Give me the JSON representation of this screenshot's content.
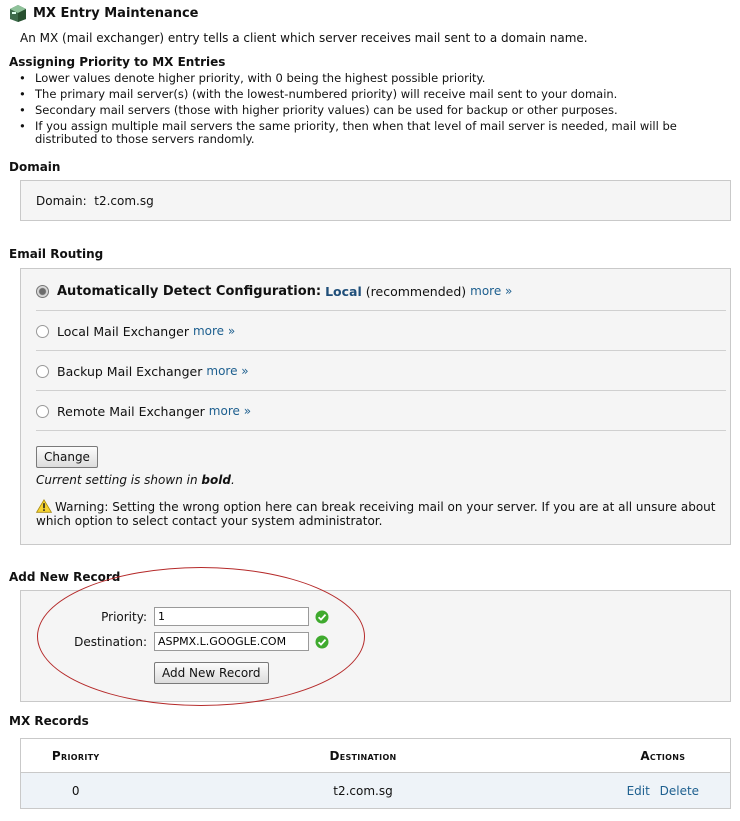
{
  "header": {
    "title": "MX Entry Maintenance",
    "icon": "mail-server-icon"
  },
  "intro": "An MX (mail exchanger) entry tells a client which server receives mail sent to a domain name.",
  "priority_section": {
    "heading": "Assigning Priority to MX Entries",
    "bullets": [
      "Lower values denote higher priority, with 0 being the highest possible priority.",
      "The primary mail server(s) (with the lowest-numbered priority) will receive mail sent to your domain.",
      "Secondary mail servers (those with higher priority values) can be used for backup or other purposes.",
      "If you assign multiple mail servers the same priority, then when that level of mail server is needed, mail will be distributed to those servers randomly."
    ]
  },
  "domain_section": {
    "heading": "Domain",
    "label": "Domain:",
    "value": "t2.com.sg"
  },
  "routing_section": {
    "heading": "Email Routing",
    "options": [
      {
        "label": "Automatically Detect Configuration:",
        "detected": "Local",
        "suffix": "(recommended)",
        "more": "more »",
        "selected": true
      },
      {
        "label": "Local Mail Exchanger",
        "more": "more »",
        "selected": false
      },
      {
        "label": "Backup Mail Exchanger",
        "more": "more »",
        "selected": false
      },
      {
        "label": "Remote Mail Exchanger",
        "more": "more »",
        "selected": false
      }
    ],
    "change_button": "Change",
    "note_prefix": "Current setting is shown in",
    "note_bold": "bold",
    "note_suffix": ".",
    "warning": "Warning: Setting the wrong option here can break receiving mail on your server. If you are at all unsure about which option to select contact your system administrator."
  },
  "add_section": {
    "heading": "Add New Record",
    "priority_label": "Priority:",
    "priority_value": "1",
    "destination_label": "Destination:",
    "destination_value": "ASPMX.L.GOOGLE.COM",
    "button": "Add New Record"
  },
  "records_section": {
    "heading": "MX Records",
    "columns": [
      "Priority",
      "Destination",
      "Actions"
    ],
    "rows": [
      {
        "priority": "0",
        "destination": "t2.com.sg",
        "edit": "Edit",
        "delete": "Delete"
      }
    ]
  },
  "colors": {
    "link": "#1d5f8f",
    "highlight_ellipse": "#b52a2a",
    "panel_bg": "#f5f5f5",
    "row_bg": "#eef3f8"
  }
}
